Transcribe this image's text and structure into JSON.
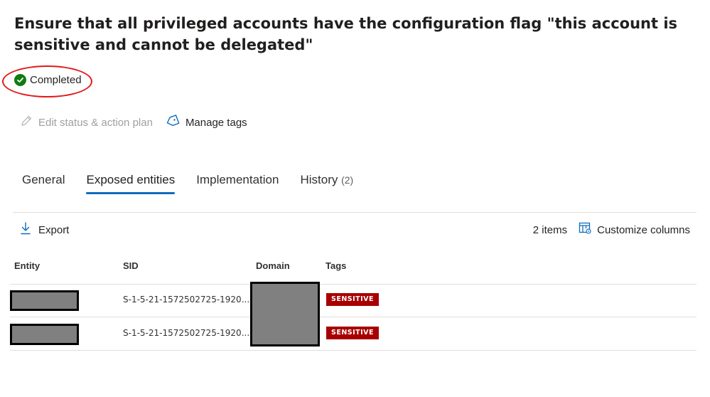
{
  "header": {
    "title": "Ensure that all privileged accounts have the configuration flag \"this account is sensitive and cannot be delegated\""
  },
  "status": {
    "label": "Completed",
    "color": "#107c10",
    "icon": "check-circle-icon"
  },
  "actions": {
    "edit_label": "Edit status & action plan",
    "manage_tags_label": "Manage tags"
  },
  "tabs": [
    {
      "label": "General",
      "active": false
    },
    {
      "label": "Exposed entities",
      "active": true
    },
    {
      "label": "Implementation",
      "active": false
    },
    {
      "label": "History",
      "count": "(2)",
      "active": false
    }
  ],
  "toolbar": {
    "export_label": "Export",
    "items_count": "2 items",
    "customize_label": "Customize columns"
  },
  "table": {
    "columns": [
      "Entity",
      "SID",
      "Domain",
      "Tags"
    ],
    "rows": [
      {
        "entity": "",
        "sid": "S-1-5-21-1572502725-1920...",
        "domain": "",
        "tag": "SENSITIVE"
      },
      {
        "entity": "",
        "sid": "S-1-5-21-1572502725-1920...",
        "domain": "",
        "tag": "SENSITIVE"
      }
    ]
  },
  "colors": {
    "accent": "#0f6cbd",
    "tag_bg": "#a80000",
    "annotation": "#e01b1b"
  }
}
